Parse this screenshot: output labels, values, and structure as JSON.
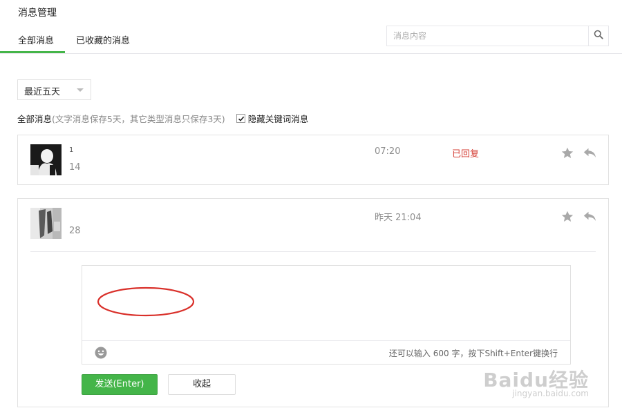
{
  "page": {
    "title": "消息管理"
  },
  "tabs": [
    {
      "label": "全部消息",
      "active": true
    },
    {
      "label": "已收藏的消息",
      "active": false
    }
  ],
  "search": {
    "placeholder": "消息内容",
    "icon": "search-icon"
  },
  "filter": {
    "range_selected": "最近五天",
    "main_label": "全部消息",
    "note": "(文字消息保存5天，其它类型消息只保存3天)",
    "hide_keywords_label": "隐藏关键词消息",
    "hide_keywords_checked": true
  },
  "messages": [
    {
      "nickname": "1",
      "text": "14",
      "time": "07:20",
      "status": "已回复"
    },
    {
      "nickname": "",
      "text": "28",
      "time": "昨天 21:04",
      "status": ""
    }
  ],
  "reply_editor": {
    "char_hint": "还可以输入 600 字，按下Shift+Enter键换行",
    "send_label": "发送(Enter)",
    "fold_label": "收起"
  },
  "colors": {
    "accent": "#44b549",
    "status_replied": "#d43c33",
    "annotation": "#d9302a"
  },
  "watermark": {
    "brand": "Baidu经验",
    "url": "jingyan.baidu.com"
  }
}
